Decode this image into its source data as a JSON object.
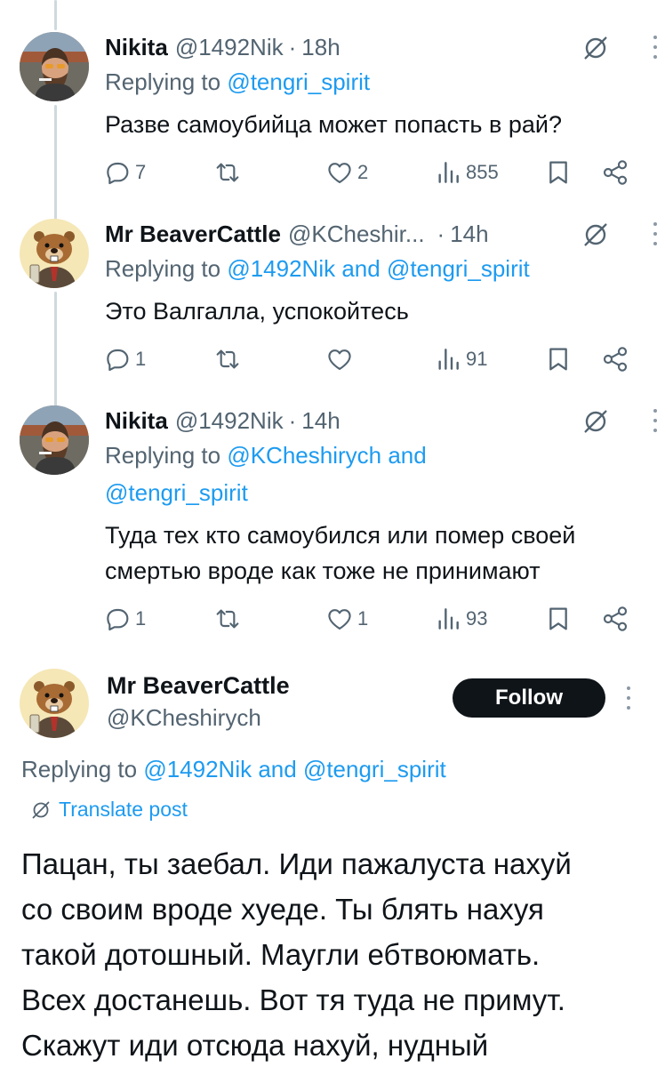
{
  "replies": [
    {
      "name": "Nikita",
      "handle": "@1492Nik",
      "dot": "·",
      "time": "18h",
      "replying_prefix": "Replying to ",
      "mention1": "@tengri_spirit",
      "and_text": "",
      "mention2": "",
      "text": "Разве самоубийца может попасть в рай?",
      "replies_count": "7",
      "retweets_count": "",
      "likes_count": "2",
      "views_count": "855"
    },
    {
      "name": "Mr BeaverCattle",
      "handle": "@KCheshir...",
      "dot": "·",
      "time": "14h",
      "replying_prefix": "Replying to ",
      "mention1": "@1492Nik",
      "and_text": " and ",
      "mention2": "@tengri_spirit",
      "text": "Это Валгалла, успокойтесь",
      "replies_count": "1",
      "retweets_count": "",
      "likes_count": "",
      "views_count": "91"
    },
    {
      "name": "Nikita",
      "handle": "@1492Nik",
      "dot": "·",
      "time": "14h",
      "replying_prefix": "Replying to ",
      "mention1": "@KCheshirych",
      "and_text": " and",
      "mention2": "@tengri_spirit",
      "text_line1": "Туда тех кто самоубился или помер своей",
      "text_line2": "смертью вроде как тоже не принимают",
      "replies_count": "1",
      "retweets_count": "",
      "likes_count": "1",
      "views_count": "93"
    }
  ],
  "main_post": {
    "name": "Mr BeaverCattle",
    "handle": "@KCheshirych",
    "follow_label": "Follow",
    "replying_prefix": "Replying to ",
    "mention1": "@1492Nik",
    "and_text": " and ",
    "mention2": "@tengri_spirit",
    "translate_label": "Translate post",
    "lines": [
      "Пацан, ты заебал. Иди пажалуста нахуй",
      "со своим вроде хуеде. Ты блять нахуя",
      "такой дотошный. Маугли ебтвоюмать.",
      "Всех достанешь. Вот тя туда не примут.",
      "Скажут иди отсюда нахуй, нудный"
    ]
  },
  "icons": {
    "reply": "reply-icon",
    "retweet": "retweet-icon",
    "like": "like-icon",
    "views": "views-icon",
    "bookmark": "bookmark-icon",
    "share": "share-icon",
    "grok": "grok-icon",
    "more": "more-icon",
    "translate": "translate-icon"
  },
  "colors": {
    "text": "#0f1419",
    "secondary": "#536471",
    "accent": "#1d9bf0",
    "thread_line": "#cfd9de",
    "follow_bg": "#0f1419"
  }
}
